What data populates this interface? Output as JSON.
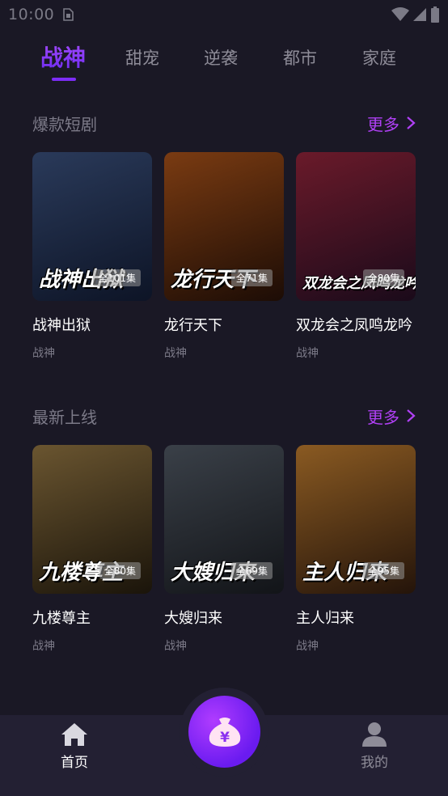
{
  "status_bar": {
    "time": "10:00"
  },
  "tabs": [
    {
      "label": "战神",
      "active": true
    },
    {
      "label": "甜宠",
      "active": false
    },
    {
      "label": "逆袭",
      "active": false
    },
    {
      "label": "都市",
      "active": false
    },
    {
      "label": "家庭",
      "active": false
    }
  ],
  "sections": [
    {
      "title": "爆款短剧",
      "more_label": "更多",
      "items": [
        {
          "name": "战神出狱",
          "tag": "战神",
          "poster_text": "战神出狱",
          "episodes": "全101集",
          "colors": [
            "#2a3a5a",
            "#0d1426"
          ]
        },
        {
          "name": "龙行天下",
          "tag": "战神",
          "poster_text": "龙行天下",
          "episodes": "全71集",
          "colors": [
            "#7a3b12",
            "#1c0c05"
          ]
        },
        {
          "name": "双龙会之凤鸣龙吟",
          "tag": "战神",
          "poster_text": "双龙会之凤鸣龙吟",
          "episodes": "全80集",
          "colors": [
            "#6a1a2a",
            "#1a0a1a"
          ]
        }
      ]
    },
    {
      "title": "最新上线",
      "more_label": "更多",
      "items": [
        {
          "name": "九楼尊主",
          "tag": "战神",
          "poster_text": "九楼尊主",
          "episodes": "全80集",
          "colors": [
            "#6a5530",
            "#1a140a"
          ]
        },
        {
          "name": "大嫂归来",
          "tag": "战神",
          "poster_text": "大嫂归来",
          "episodes": "全69集",
          "colors": [
            "#3a4048",
            "#121418"
          ]
        },
        {
          "name": "主人归来",
          "tag": "战神",
          "poster_text": "主人归来",
          "episodes": "全95集",
          "colors": [
            "#8a5a22",
            "#24140a"
          ]
        }
      ]
    }
  ],
  "bottom_nav": {
    "home_label": "首页",
    "mine_label": "我的",
    "center_icon": "money-bag-icon"
  },
  "accent_color": "#a43cf5"
}
